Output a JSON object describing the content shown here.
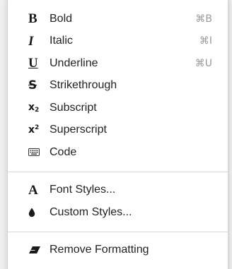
{
  "menu": {
    "format_items": [
      {
        "label": "Bold",
        "shortcut": "⌘B",
        "icon": "bold-icon"
      },
      {
        "label": "Italic",
        "shortcut": "⌘I",
        "icon": "italic-icon"
      },
      {
        "label": "Underline",
        "shortcut": "⌘U",
        "icon": "underline-icon"
      },
      {
        "label": "Strikethrough",
        "shortcut": "",
        "icon": "strikethrough-icon"
      },
      {
        "label": "Subscript",
        "shortcut": "",
        "icon": "subscript-icon"
      },
      {
        "label": "Superscript",
        "shortcut": "",
        "icon": "superscript-icon"
      },
      {
        "label": "Code",
        "shortcut": "",
        "icon": "keyboard-icon"
      }
    ],
    "style_items": [
      {
        "label": "Font Styles...",
        "icon": "font-icon"
      },
      {
        "label": "Custom Styles...",
        "icon": "drop-icon"
      }
    ],
    "remove_item": {
      "label": "Remove Formatting",
      "icon": "eraser-icon"
    }
  }
}
